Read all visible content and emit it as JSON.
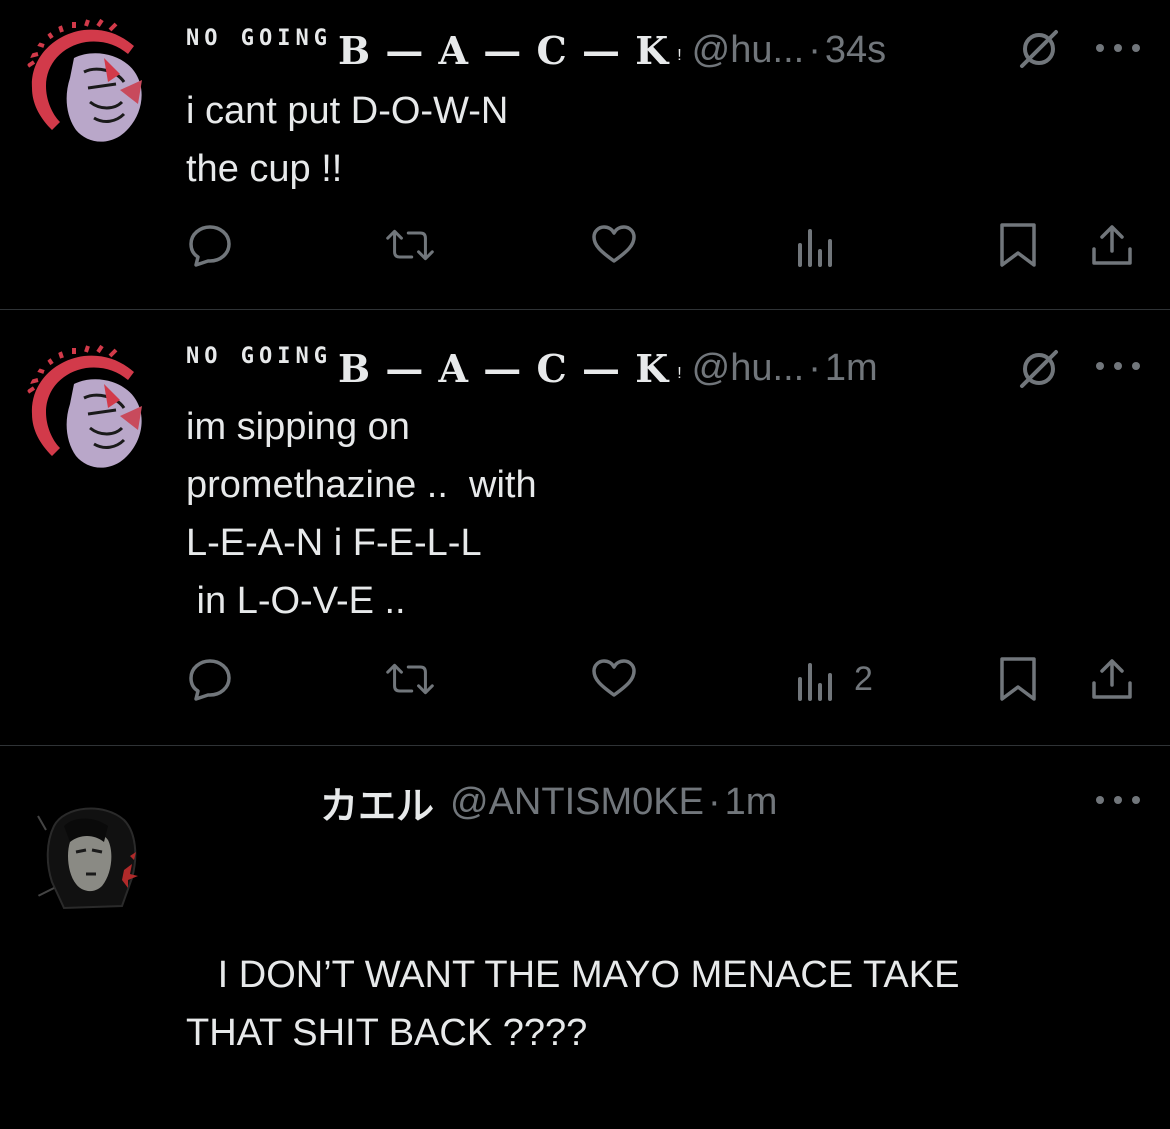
{
  "colors": {
    "background": "#000000",
    "text": "#e7e9ea",
    "muted": "#71767b",
    "divider": "#2f3336"
  },
  "tweets": [
    {
      "name_prefix": "NO GOING",
      "name_main": "B — A — C — K",
      "name_suffix": "!",
      "handle": "@hu...",
      "dot": "·",
      "time": "34s",
      "text": "i cant put D-O-W-N\nthe cup !!",
      "views_count": "",
      "icons": {
        "grok": "grok-icon",
        "more": "more-icon"
      }
    },
    {
      "name_prefix": "NO GOING",
      "name_main": "B — A — C — K",
      "name_suffix": "!",
      "handle": "@hu...",
      "dot": "·",
      "time": "1m",
      "text": "im sipping on\npromethazine ..  with\nL-E-A-N i F-E-L-L\n in L-O-V-E ..",
      "views_count": "2",
      "icons": {
        "grok": "grok-icon",
        "more": "more-icon"
      }
    },
    {
      "name": "カエル",
      "handle": "@ANTISM0KE",
      "dot": "·",
      "time": "1m",
      "text": "   I DON’T WANT THE MAYO MENACE TAKE\nTHAT SHIT BACK ????",
      "icons": {
        "more": "more-icon"
      }
    }
  ]
}
